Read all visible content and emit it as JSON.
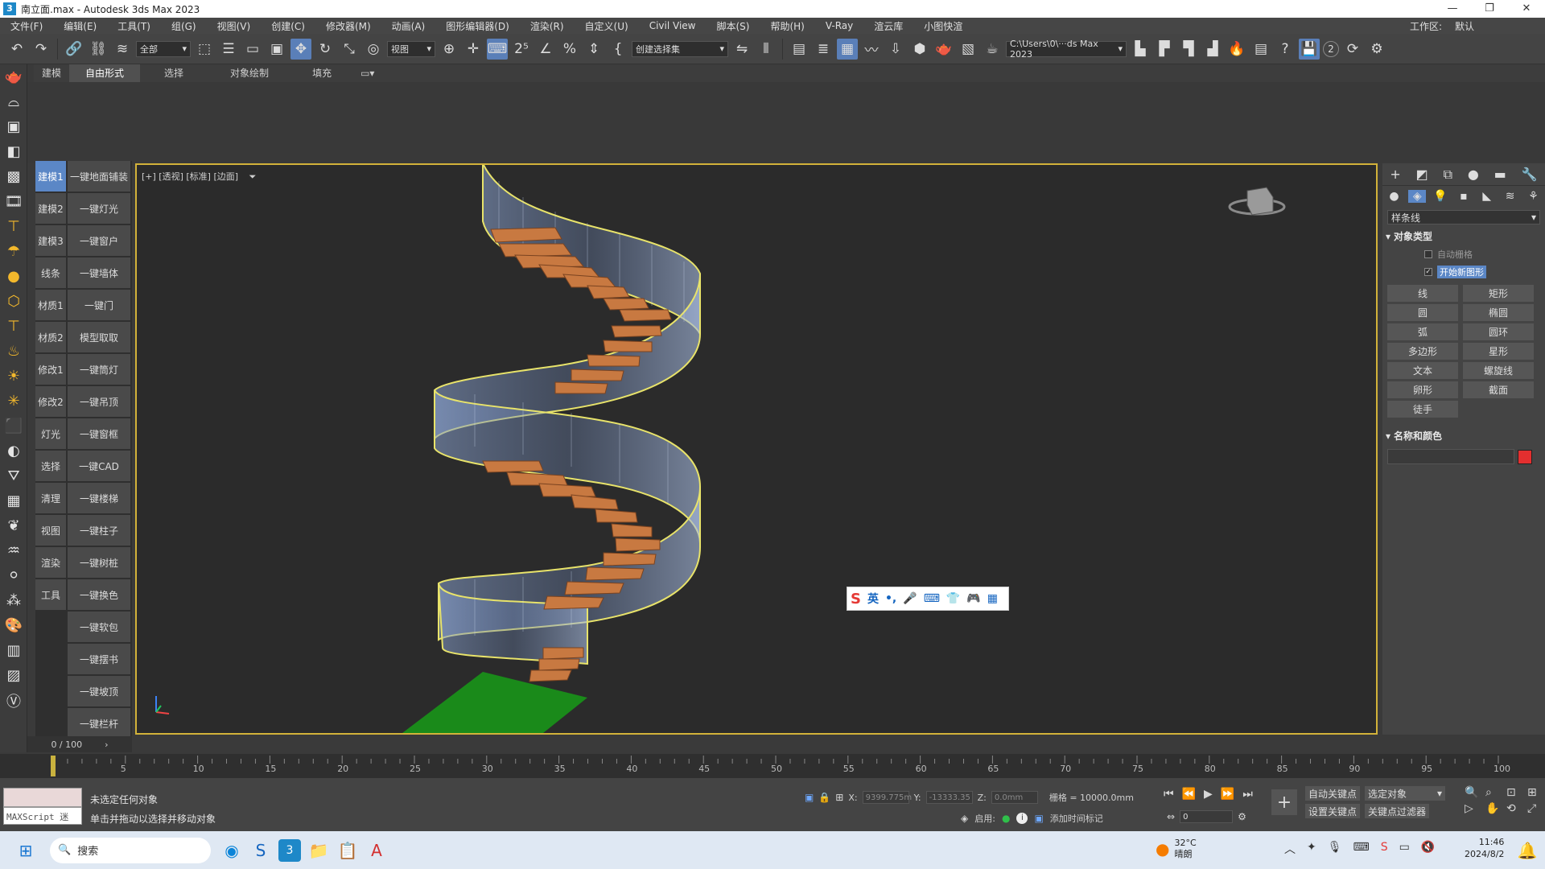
{
  "window": {
    "title": "南立面.max - Autodesk 3ds Max 2023",
    "controls": [
      "—",
      "❐",
      "✕"
    ]
  },
  "menubar": {
    "items": [
      "文件(F)",
      "编辑(E)",
      "工具(T)",
      "组(G)",
      "视图(V)",
      "创建(C)",
      "修改器(M)",
      "动画(A)",
      "图形编辑器(D)",
      "渲染(R)",
      "自定义(U)",
      "Civil View",
      "脚本(S)",
      "帮助(H)",
      "V-Ray",
      "渲云库",
      "小图快渲"
    ],
    "workspace_label": "工作区:",
    "workspace_value": "默认"
  },
  "toolbar": {
    "selection_filter": "全部",
    "ref_coord": "视图",
    "named_selection": "创建选择集",
    "project_path": "C:\\Users\\0\\···ds Max 2023",
    "badge_number": "2"
  },
  "ribbon": {
    "tabs": [
      "建模",
      "自由形式",
      "选择",
      "对象绘制",
      "填充"
    ]
  },
  "script_panel": {
    "rows": [
      {
        "left": "建模1",
        "right": "一键地面铺装"
      },
      {
        "left": "建模2",
        "right": "一键灯光"
      },
      {
        "left": "建模3",
        "right": "一键窗户"
      },
      {
        "left": "线条",
        "right": "一键墙体"
      },
      {
        "left": "材质1",
        "right": "一键门"
      },
      {
        "left": "材质2",
        "right": "模型取取"
      },
      {
        "left": "修改1",
        "right": "一键筒灯"
      },
      {
        "left": "修改2",
        "right": "一键吊顶"
      },
      {
        "left": "灯光",
        "right": "一键窗框"
      },
      {
        "left": "选择",
        "right": "一键CAD"
      },
      {
        "left": "清理",
        "right": "一键楼梯"
      },
      {
        "left": "视图",
        "right": "一键柱子"
      },
      {
        "left": "渲染",
        "right": "一键树桩"
      },
      {
        "left": "工具",
        "right": "一键换色"
      },
      {
        "left": "",
        "right": "一键软包"
      },
      {
        "left": "",
        "right": "一键摆书"
      },
      {
        "left": "",
        "right": "一键坡顶"
      },
      {
        "left": "",
        "right": "一键栏杆"
      }
    ]
  },
  "viewport": {
    "label": "[+] [透视] [标准] [边面]"
  },
  "command_panel": {
    "category_dropdown": "样条线",
    "rollout_object_type": "对象类型",
    "auto_grid": "自动栅格",
    "start_new_shape": "开始新图形",
    "buttons": [
      "线",
      "矩形",
      "圆",
      "椭圆",
      "弧",
      "圆环",
      "多边形",
      "星形",
      "文本",
      "螺旋线",
      "卵形",
      "截面",
      "徒手"
    ],
    "rollout_name_color": "名称和颜色",
    "color": "#e32f2f"
  },
  "timeline": {
    "frame_display": "0 / 100",
    "ticks": [
      "5",
      "10",
      "15",
      "20",
      "25",
      "30",
      "35",
      "40",
      "45",
      "50",
      "55",
      "60",
      "65",
      "70",
      "75",
      "80",
      "85",
      "90",
      "95",
      "100"
    ]
  },
  "status": {
    "maxscript_label": "MAXScript 迷",
    "line1": "未选定任何对象",
    "line2": "单击并拖动以选择并移动对象",
    "x_label": "X:",
    "x_value": "9399.775m",
    "y_label": "Y:",
    "y_value": "-13333.35",
    "z_label": "Z:",
    "z_value": "0.0mm",
    "grid": "栅格 = 10000.0mm",
    "enable_label": "启用:",
    "add_time_tag": "添加时间标记",
    "auto_key": "自动关键点",
    "selected_object": "选定对象",
    "set_key": "设置关键点",
    "key_filter": "关键点过滤器",
    "frame_value": "0"
  },
  "taskbar": {
    "search_placeholder": "搜索",
    "weather_temp": "32°C",
    "weather_desc": "晴朗",
    "time": "11:46",
    "date": "2024/8/2"
  }
}
